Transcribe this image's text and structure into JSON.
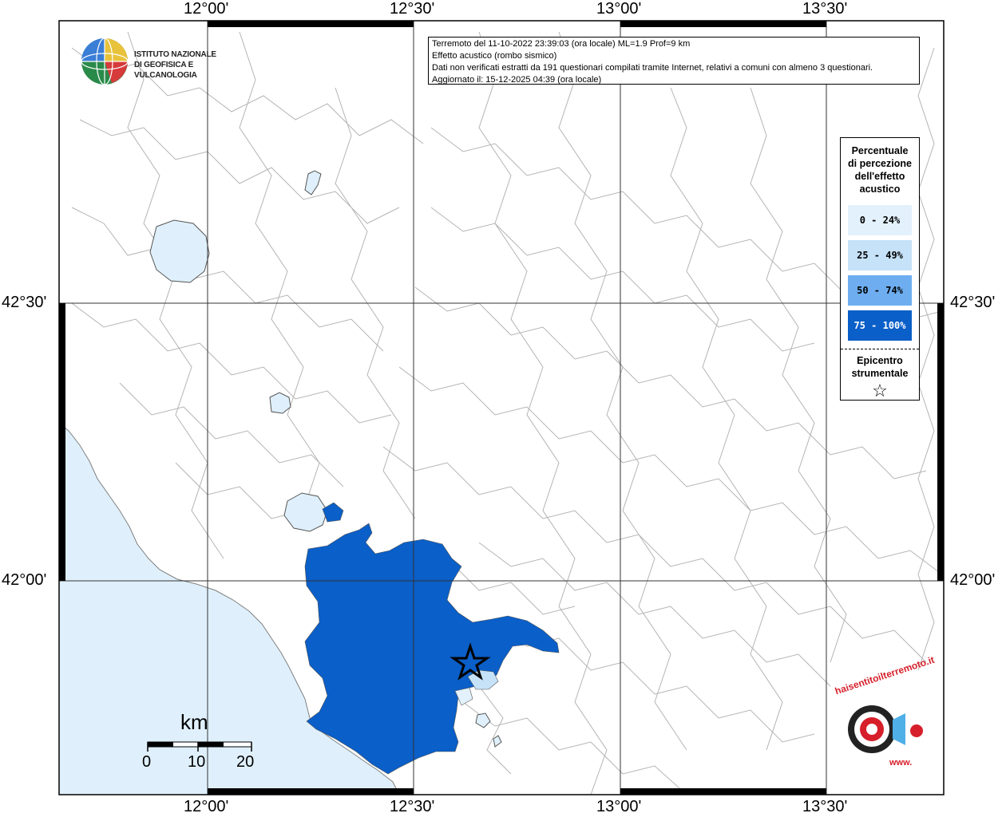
{
  "info": {
    "line1": "Terremoto del 11-10-2022 23:39:03 (ora locale) ML=1.9 Prof=9 km",
    "line2": "Effetto acustico (rombo sismico)",
    "line3": "Dati non verificati estratti da 191 questionari compilati tramite Internet, relativi a comuni con almeno 3 questionari.",
    "line4": "Aggiornato il: 15-12-2025 04:39 (ora locale)"
  },
  "logo": {
    "line1": "ISTITUTO NAZIONALE",
    "line2": "DI GEOFISICA E VULCANOLOGIA"
  },
  "axes": {
    "top": [
      "12°00'",
      "12°30'",
      "13°00'",
      "13°30'"
    ],
    "bottom": [
      "12°00'",
      "12°30'",
      "13°00'",
      "13°30'"
    ],
    "left": [
      "42°30'",
      "42°00'"
    ],
    "right": [
      "42°30'",
      "42°00'"
    ]
  },
  "legend": {
    "title": [
      "Percentuale",
      "di percezione",
      "dell'effetto",
      "acustico"
    ],
    "classes": [
      {
        "label": "0 - 24%",
        "color": "#e3f1fc",
        "text": "#000000"
      },
      {
        "label": "25 - 49%",
        "color": "#c6e2f8",
        "text": "#000000"
      },
      {
        "label": "50 - 74%",
        "color": "#6eaef0",
        "text": "#000000"
      },
      {
        "label": "75 - 100%",
        "color": "#0a5fc8",
        "text": "#ffffff"
      }
    ],
    "epicenter_title": [
      "Epicentro",
      "strumentale"
    ],
    "epicenter_symbol": "☆"
  },
  "scale": {
    "unit": "km",
    "ticks": [
      "0",
      "10",
      "20"
    ]
  },
  "badge": {
    "text": "haisentitoilterremoto.it",
    "prefix": "www."
  },
  "colors": {
    "sea": "#dff0fc",
    "lake": "#dff0fc",
    "high": "#0a5fc8",
    "low": "#c6e2f8",
    "grid": "#333333",
    "boundary": "#b4b4b4"
  }
}
